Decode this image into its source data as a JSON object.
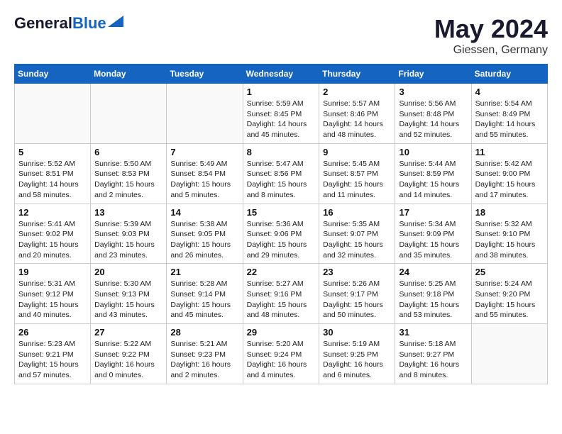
{
  "header": {
    "logo_general": "General",
    "logo_blue": "Blue",
    "month": "May 2024",
    "location": "Giessen, Germany"
  },
  "weekdays": [
    "Sunday",
    "Monday",
    "Tuesday",
    "Wednesday",
    "Thursday",
    "Friday",
    "Saturday"
  ],
  "weeks": [
    [
      {
        "day": "",
        "info": ""
      },
      {
        "day": "",
        "info": ""
      },
      {
        "day": "",
        "info": ""
      },
      {
        "day": "1",
        "info": "Sunrise: 5:59 AM\nSunset: 8:45 PM\nDaylight: 14 hours\nand 45 minutes."
      },
      {
        "day": "2",
        "info": "Sunrise: 5:57 AM\nSunset: 8:46 PM\nDaylight: 14 hours\nand 48 minutes."
      },
      {
        "day": "3",
        "info": "Sunrise: 5:56 AM\nSunset: 8:48 PM\nDaylight: 14 hours\nand 52 minutes."
      },
      {
        "day": "4",
        "info": "Sunrise: 5:54 AM\nSunset: 8:49 PM\nDaylight: 14 hours\nand 55 minutes."
      }
    ],
    [
      {
        "day": "5",
        "info": "Sunrise: 5:52 AM\nSunset: 8:51 PM\nDaylight: 14 hours\nand 58 minutes."
      },
      {
        "day": "6",
        "info": "Sunrise: 5:50 AM\nSunset: 8:53 PM\nDaylight: 15 hours\nand 2 minutes."
      },
      {
        "day": "7",
        "info": "Sunrise: 5:49 AM\nSunset: 8:54 PM\nDaylight: 15 hours\nand 5 minutes."
      },
      {
        "day": "8",
        "info": "Sunrise: 5:47 AM\nSunset: 8:56 PM\nDaylight: 15 hours\nand 8 minutes."
      },
      {
        "day": "9",
        "info": "Sunrise: 5:45 AM\nSunset: 8:57 PM\nDaylight: 15 hours\nand 11 minutes."
      },
      {
        "day": "10",
        "info": "Sunrise: 5:44 AM\nSunset: 8:59 PM\nDaylight: 15 hours\nand 14 minutes."
      },
      {
        "day": "11",
        "info": "Sunrise: 5:42 AM\nSunset: 9:00 PM\nDaylight: 15 hours\nand 17 minutes."
      }
    ],
    [
      {
        "day": "12",
        "info": "Sunrise: 5:41 AM\nSunset: 9:02 PM\nDaylight: 15 hours\nand 20 minutes."
      },
      {
        "day": "13",
        "info": "Sunrise: 5:39 AM\nSunset: 9:03 PM\nDaylight: 15 hours\nand 23 minutes."
      },
      {
        "day": "14",
        "info": "Sunrise: 5:38 AM\nSunset: 9:05 PM\nDaylight: 15 hours\nand 26 minutes."
      },
      {
        "day": "15",
        "info": "Sunrise: 5:36 AM\nSunset: 9:06 PM\nDaylight: 15 hours\nand 29 minutes."
      },
      {
        "day": "16",
        "info": "Sunrise: 5:35 AM\nSunset: 9:07 PM\nDaylight: 15 hours\nand 32 minutes."
      },
      {
        "day": "17",
        "info": "Sunrise: 5:34 AM\nSunset: 9:09 PM\nDaylight: 15 hours\nand 35 minutes."
      },
      {
        "day": "18",
        "info": "Sunrise: 5:32 AM\nSunset: 9:10 PM\nDaylight: 15 hours\nand 38 minutes."
      }
    ],
    [
      {
        "day": "19",
        "info": "Sunrise: 5:31 AM\nSunset: 9:12 PM\nDaylight: 15 hours\nand 40 minutes."
      },
      {
        "day": "20",
        "info": "Sunrise: 5:30 AM\nSunset: 9:13 PM\nDaylight: 15 hours\nand 43 minutes."
      },
      {
        "day": "21",
        "info": "Sunrise: 5:28 AM\nSunset: 9:14 PM\nDaylight: 15 hours\nand 45 minutes."
      },
      {
        "day": "22",
        "info": "Sunrise: 5:27 AM\nSunset: 9:16 PM\nDaylight: 15 hours\nand 48 minutes."
      },
      {
        "day": "23",
        "info": "Sunrise: 5:26 AM\nSunset: 9:17 PM\nDaylight: 15 hours\nand 50 minutes."
      },
      {
        "day": "24",
        "info": "Sunrise: 5:25 AM\nSunset: 9:18 PM\nDaylight: 15 hours\nand 53 minutes."
      },
      {
        "day": "25",
        "info": "Sunrise: 5:24 AM\nSunset: 9:20 PM\nDaylight: 15 hours\nand 55 minutes."
      }
    ],
    [
      {
        "day": "26",
        "info": "Sunrise: 5:23 AM\nSunset: 9:21 PM\nDaylight: 15 hours\nand 57 minutes."
      },
      {
        "day": "27",
        "info": "Sunrise: 5:22 AM\nSunset: 9:22 PM\nDaylight: 16 hours\nand 0 minutes."
      },
      {
        "day": "28",
        "info": "Sunrise: 5:21 AM\nSunset: 9:23 PM\nDaylight: 16 hours\nand 2 minutes."
      },
      {
        "day": "29",
        "info": "Sunrise: 5:20 AM\nSunset: 9:24 PM\nDaylight: 16 hours\nand 4 minutes."
      },
      {
        "day": "30",
        "info": "Sunrise: 5:19 AM\nSunset: 9:25 PM\nDaylight: 16 hours\nand 6 minutes."
      },
      {
        "day": "31",
        "info": "Sunrise: 5:18 AM\nSunset: 9:27 PM\nDaylight: 16 hours\nand 8 minutes."
      },
      {
        "day": "",
        "info": ""
      }
    ]
  ]
}
